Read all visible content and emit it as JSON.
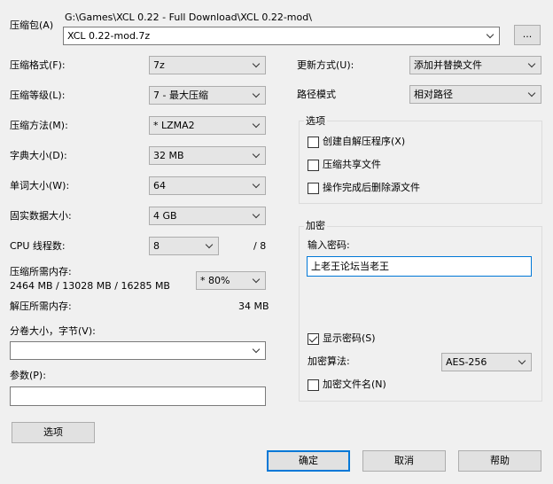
{
  "archive": {
    "label": "压缩包(A)",
    "path": "G:\\Games\\XCL 0.22 - Full Download\\XCL 0.22-mod\\",
    "name": "XCL 0.22-mod.7z",
    "browse_label": "..."
  },
  "left": {
    "format_label": "压缩格式(F):",
    "format_value": "7z",
    "level_label": "压缩等级(L):",
    "level_value": "7 - 最大压缩",
    "method_label": "压缩方法(M):",
    "method_value": "* LZMA2",
    "dict_label": "字典大小(D):",
    "dict_value": "32 MB",
    "word_label": "单词大小(W):",
    "word_value": "64",
    "solid_label": "固实数据大小:",
    "solid_value": "4 GB",
    "threads_label": "CPU 线程数:",
    "threads_value": "8",
    "threads_total": "/ 8",
    "mem_label": "压缩所需内存:",
    "mem_detail": "2464 MB / 13028 MB / 16285 MB",
    "mem_value": "* 80%",
    "decomp_label": "解压所需内存:",
    "decomp_value": "34 MB",
    "split_label": "分卷大小，字节(V):",
    "split_value": "",
    "params_label": "参数(P):",
    "params_value": "",
    "options_button": "选项"
  },
  "right": {
    "update_label": "更新方式(U):",
    "update_value": "添加并替换文件",
    "path_label": "路径模式",
    "path_value": "相对路径",
    "options_group": "选项",
    "opt_sfx": "创建自解压程序(X)",
    "opt_shared": "压缩共享文件",
    "opt_delete": "操作完成后删除源文件",
    "enc_group": "加密",
    "enc_password_label": "输入密码:",
    "enc_password_value": "上老王论坛当老王",
    "enc_show_password": "显示密码(S)",
    "enc_method_label": "加密算法:",
    "enc_method_value": "AES-256",
    "enc_filenames": "加密文件名(N)"
  },
  "buttons": {
    "ok": "确定",
    "cancel": "取消",
    "help": "帮助"
  },
  "colors": {
    "background": "#f0f0f0",
    "focus_border": "#0078d7"
  }
}
